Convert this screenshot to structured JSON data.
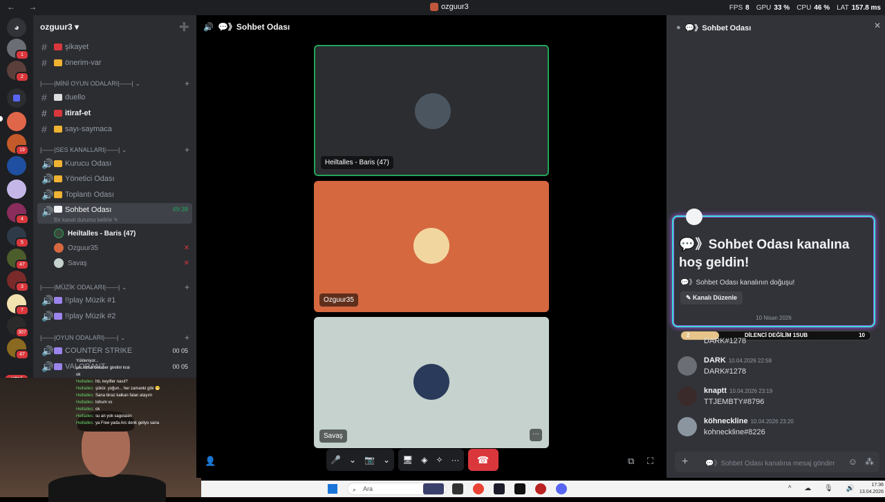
{
  "window": {
    "title": "ozguur3",
    "nav_arrows": "← →"
  },
  "overlay": [
    {
      "k": "FPS",
      "v": "8"
    },
    {
      "k": "GPU",
      "v": "33 %"
    },
    {
      "k": "CPU",
      "v": "46 %"
    },
    {
      "k": "LAT",
      "v": "157.8 ms"
    }
  ],
  "servers": {
    "badges": [
      "1",
      "2",
      "19",
      "4",
      "3",
      "5",
      "47",
      "3",
      "7",
      "307",
      "47",
      "93"
    ],
    "new_label": "YENİ"
  },
  "guild": {
    "name": "ozguur3 ▾"
  },
  "channels": {
    "sikayet": "şikayet",
    "onerim": "önerim-var",
    "cat_mini": "|——|MİNİ OYUN ODALARI|——| ⌄",
    "duello": "duello",
    "itiraf": "itiraf-et",
    "sayi": "sayı-saymaca",
    "cat_ses": "|——|SES KANALLARI|——| ⌄",
    "kurucu": "Kurucu Odası",
    "yonetici": "Yönetici Odası",
    "toplanti": "Toplantı Odası",
    "sohbet": "Sohbet Odası",
    "sohbet_time": "49:38",
    "status_hint": "Bir kanal durumu belirle ✎",
    "cat_muzik": "|——|MÜZİK ODALARI|——| ⌄",
    "muzik1": "!!play Müzik #1",
    "muzik2": "!!play Müzik #2",
    "cat_oyun": "|——|OYUN ODALARI|——| ⌄",
    "cs": "COUNTER STRIKE",
    "valorant": "VALORANT",
    "counts": "00 05"
  },
  "voice_users": [
    {
      "name": "Heiltalles - Baris (47)"
    },
    {
      "name": "Ozguur35"
    },
    {
      "name": "Savaş"
    }
  ],
  "stream_chat": [
    {
      "n": "",
      "t": "Yükleniyor..."
    },
    {
      "n": "",
      "t": "yer varsa beraber girelim krai"
    },
    {
      "n": "",
      "t": "ok"
    },
    {
      "n": "Heiltalles",
      "t": "hb, keyifler nasıl?"
    },
    {
      "n": "Heiltalles",
      "t": "şükür. yoğun... her zamanki gibi 😁"
    },
    {
      "n": "Heiltalles",
      "t": "Sana biraz kalkan falan atayım"
    },
    {
      "n": "Heiltalles",
      "t": "tohum vs"
    },
    {
      "n": "Heiltalles",
      "t": "ok"
    },
    {
      "n": "Heiltalles",
      "t": "su an yok sagolasin"
    },
    {
      "n": "Heiltalles",
      "t": "ya Free yada Arc denk geliyo sana"
    }
  ],
  "stage": {
    "channel": "💬》Sohbet Odası",
    "tiles": [
      {
        "name": "Heiltalles - Baris (47)",
        "color": "#2b2d31"
      },
      {
        "name": "Ozguur35",
        "color": "#d5683f"
      },
      {
        "name": "Savaş",
        "color": "#c5d2cd"
      }
    ],
    "more": "···",
    "controls": {
      "mic": "🎤",
      "cam": "📷",
      "share": "🖥",
      "apps": "◈",
      "soundboard": "✧",
      "more": "···",
      "hangup": "☎"
    }
  },
  "side": {
    "title": "💬》Sohbet Odası",
    "welcome_title": "💬》Sohbet Odası kanalına hoş geldin!",
    "welcome_desc": "💬》Sohbet Odası kanalının doğuşu!",
    "edit_btn": "✎ Kanalı Düzenle",
    "date": "10 Nisan 2026",
    "subbar": {
      "left": "2",
      "center": "DİLENCİ DEĞİLİM 1SUB",
      "right": "10",
      "progress": 0.2
    },
    "messages": [
      {
        "user": "DARK",
        "time": "10.04.2026 22:58",
        "text": "DARK#1278"
      },
      {
        "user": "knaptt",
        "time": "10.04.2026 23:19",
        "text": "TTJEMBTY#8796"
      },
      {
        "user": "köhneckline",
        "time": "10.04.2026 23:20",
        "text": "kohneckline#8226"
      }
    ],
    "partial_msg": "DARK#1278",
    "input_placeholder": "💬》Sohbet Odası kanalına mesaj gönder"
  },
  "taskbar": {
    "search": "Ara",
    "tray": "^ ☁ 🎙 🔊",
    "time": "17:36",
    "date": "13.04.2026"
  },
  "colors": {
    "accent_green": "#23a55a",
    "danger": "#da373c",
    "teal_border": "#35e0d7"
  }
}
